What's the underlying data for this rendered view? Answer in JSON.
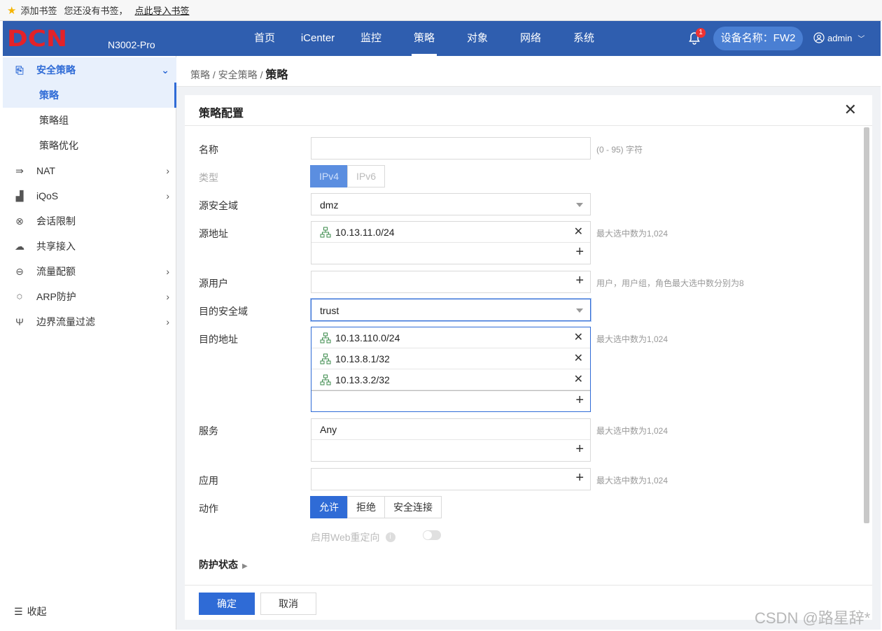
{
  "bookmark_bar": {
    "add": "添加书签",
    "empty": "您还没有书签，",
    "import": "点此导入书签"
  },
  "header": {
    "logo": "DCN",
    "model": "N3002-Pro",
    "nav": [
      "首页",
      "iCenter",
      "监控",
      "策略",
      "对象",
      "网络",
      "系统"
    ],
    "active_nav": "策略",
    "notification_count": "1",
    "device_name": "设备名称：FW2",
    "user": "admin"
  },
  "sidebar": {
    "items": [
      {
        "label": "安全策略",
        "icon": "policy-icon"
      },
      {
        "label": "策略"
      },
      {
        "label": "策略组"
      },
      {
        "label": "策略优化"
      },
      {
        "label": "NAT",
        "icon": "nat-icon"
      },
      {
        "label": "iQoS",
        "icon": "qos-icon"
      },
      {
        "label": "会话限制",
        "icon": "session-icon"
      },
      {
        "label": "共享接入",
        "icon": "cloud-icon"
      },
      {
        "label": "流量配额",
        "icon": "quota-icon"
      },
      {
        "label": "ARP防护",
        "icon": "arp-icon"
      },
      {
        "label": "边界流量过滤",
        "icon": "filter-icon"
      }
    ],
    "collapse": "收起"
  },
  "breadcrumb": {
    "p1": "策略",
    "sep": "/",
    "p2": "安全策略",
    "current": "策略"
  },
  "form": {
    "title": "策略配置",
    "name": {
      "label": "名称",
      "value": "",
      "hint": "(0 - 95) 字符"
    },
    "type": {
      "label": "类型",
      "options": [
        "IPv4",
        "IPv6"
      ],
      "selected": "IPv4"
    },
    "src_zone": {
      "label": "源安全域",
      "value": "dmz"
    },
    "src_addr": {
      "label": "源地址",
      "items": [
        "10.13.11.0/24"
      ],
      "hint": "最大选中数为1,024"
    },
    "src_user": {
      "label": "源用户",
      "hint": "用户，用户组，角色最大选中数分别为8"
    },
    "dst_zone": {
      "label": "目的安全域",
      "value": "trust"
    },
    "dst_addr": {
      "label": "目的地址",
      "items": [
        "10.13.110.0/24",
        "10.13.8.1/32",
        "10.13.3.2/32"
      ],
      "hint": "最大选中数为1,024"
    },
    "service": {
      "label": "服务",
      "items": [
        "Any"
      ],
      "hint": "最大选中数为1,024"
    },
    "app": {
      "label": "应用",
      "hint": "最大选中数为1,024"
    },
    "action": {
      "label": "动作",
      "options": [
        "允许",
        "拒绝",
        "安全连接"
      ],
      "selected": "允许"
    },
    "web_redirect": {
      "label": "启用Web重定向",
      "enabled": false
    },
    "protection": "防护状态",
    "ok": "确定",
    "cancel": "取消"
  },
  "watermark": "CSDN @路星辞*",
  "colors": {
    "header": "#2f5eaf",
    "accent": "#2f6bd6",
    "logo": "#e32229"
  }
}
